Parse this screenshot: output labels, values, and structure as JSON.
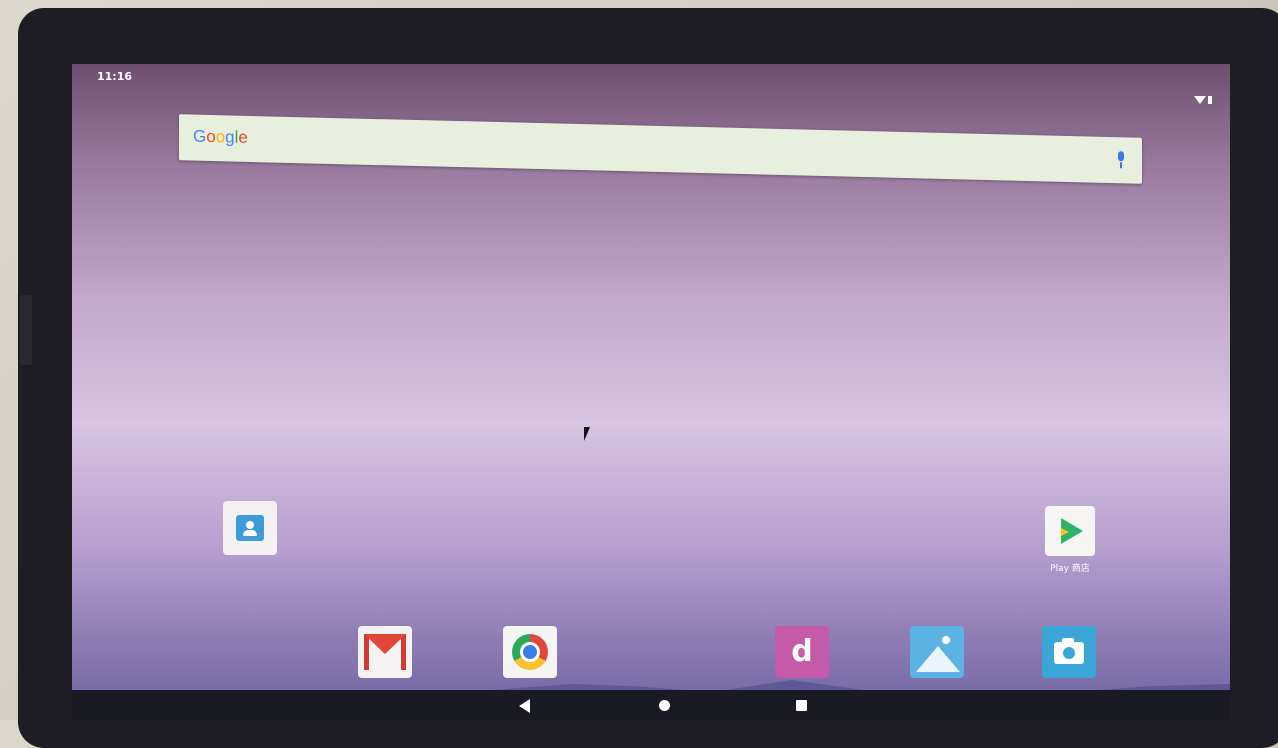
{
  "status_bar": {
    "time": "11:16",
    "icons": [
      "wifi-icon",
      "battery-icon"
    ]
  },
  "search": {
    "brand": "Google",
    "mic_icon": "mic-icon"
  },
  "desktop_apps": [
    {
      "label": "",
      "icon": "contacts-icon"
    },
    {
      "label": "Play 商店",
      "icon": "play-store-icon"
    }
  ],
  "dock": [
    "gmail-icon",
    "chrome-icon",
    "music-icon",
    "gallery-icon",
    "camera-icon"
  ],
  "nav_bar": [
    "back-icon",
    "home-icon",
    "recents-icon"
  ]
}
